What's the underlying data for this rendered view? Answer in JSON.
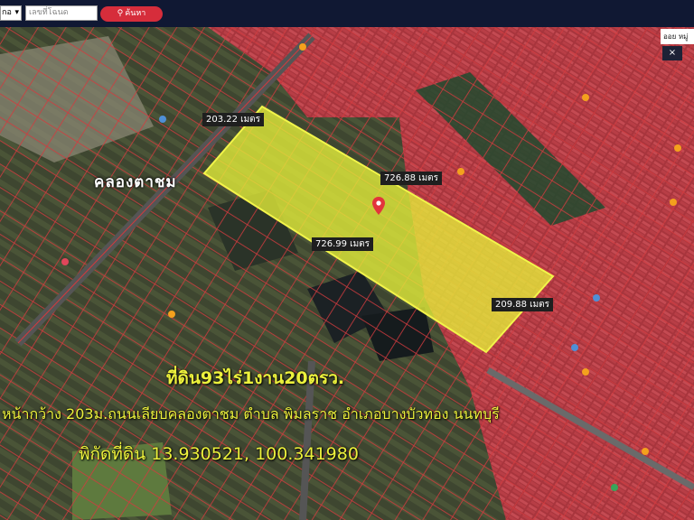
{
  "search": {
    "select_value": "กอ",
    "placeholder": "เลขที่โฉนด",
    "button_label": "ค้นหา"
  },
  "map": {
    "layers_label": "ออย หมู่",
    "close_label": "×",
    "canal_label": "คลองตาชม",
    "measurements": {
      "top_left": "203.22 เมตร",
      "top_right": "726.88 เมตร",
      "bottom": "726.99 เมตร",
      "right": "209.88 เมตร"
    },
    "headline": "ที่ดิน93ไร่1งาน20ตรว.",
    "details": "หน้ากว้าง 203ม.ถนนเลียบคลองตาชม ตำบล พิมลราช อำเภอบางบัวทอง นนทบุรี",
    "coordinates": "พิกัดที่ดิน 13.930521, 100.341980",
    "colors": {
      "parcel_fill": "#e6f03a",
      "parcel_lines": "#e8383a",
      "label_text": "#ecf13c",
      "header_bg": "#101833",
      "search_button": "#d62d3b"
    }
  }
}
